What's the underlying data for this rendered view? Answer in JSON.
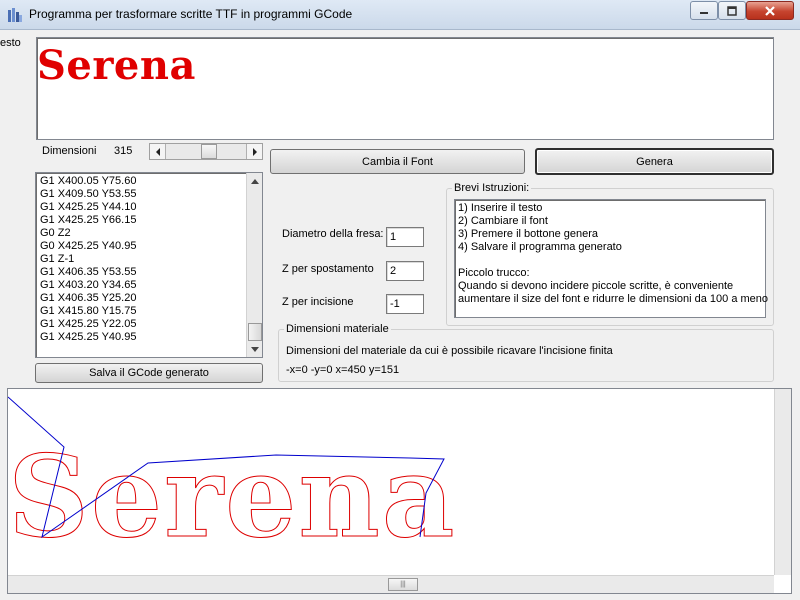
{
  "window": {
    "title": "Programma per trasformare scritte TTF in programmi GCode",
    "minimize_icon": "minimize-icon",
    "maximize_icon": "maximize-icon",
    "close_icon": "close-icon"
  },
  "left_label": "esto",
  "preview": {
    "text": "Serena",
    "color": "#e00000"
  },
  "dimensions": {
    "label": "Dimensioni",
    "value": "315",
    "slider_fraction": 0.55
  },
  "buttons": {
    "cambia_font": "Cambia il Font",
    "genera": "Genera",
    "salva": "Salva il GCode generato"
  },
  "gcode_lines": [
    "G1 X400.05 Y75.60",
    "G1 X409.50 Y53.55",
    "G1 X425.25 Y44.10",
    "G1 X425.25 Y66.15",
    "G0 Z2",
    "G0 X425.25 Y40.95",
    "G1 Z-1",
    "G1 X406.35 Y53.55",
    "G1 X403.20 Y34.65",
    "G1 X406.35 Y25.20",
    "G1 X415.80 Y15.75",
    "G1 X425.25 Y22.05",
    "G1 X425.25 Y40.95"
  ],
  "params": {
    "diametro_label": "Diametro della fresa:",
    "diametro_value": "1",
    "zspost_label": "Z per spostamento",
    "zspost_value": "2",
    "zinc_label": "Z per incisione",
    "zinc_value": "-1"
  },
  "istruzioni": {
    "title": "Brevi Istruzioni:",
    "lines": [
      "1) Inserire il testo",
      "2) Cambiare il font",
      "3) Premere il bottone genera",
      "4) Salvare il programma generato",
      "",
      "Piccolo trucco:",
      "Quando si devono incidere piccole scritte, è conveniente",
      "aumentare il size del font e ridurre le dimensioni da 100 a meno"
    ]
  },
  "materiale": {
    "title": "Dimensioni materiale",
    "description": "Dimensioni del materiale da cui è possibile ricavare l'incisione finita",
    "values": "-x=0 -y=0 x=450 y=151"
  },
  "canvas": {
    "text": "Serena",
    "outline_color": "#dd0000",
    "path_color": "#0000cc"
  }
}
